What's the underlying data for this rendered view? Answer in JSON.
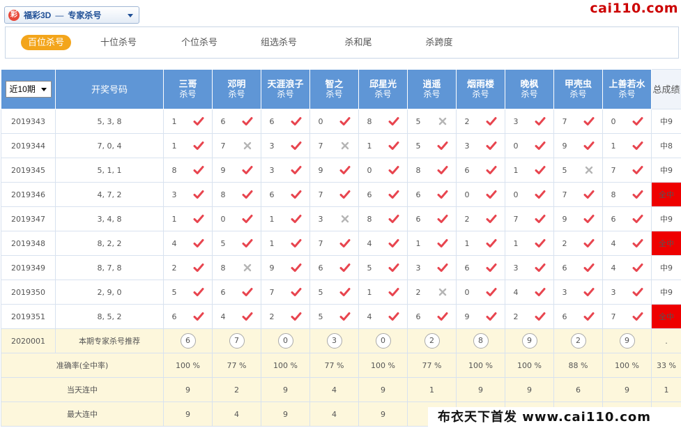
{
  "header": {
    "game_logo": "彩",
    "game_name": "福彩3D",
    "game_sep": "—",
    "game_sub": "专家杀号",
    "brand": "cai110.com"
  },
  "tabs": [
    {
      "label": "百位杀号",
      "active": true
    },
    {
      "label": "十位杀号",
      "active": false
    },
    {
      "label": "个位杀号",
      "active": false
    },
    {
      "label": "组选杀号",
      "active": false
    },
    {
      "label": "杀和尾",
      "active": false
    },
    {
      "label": "杀跨度",
      "active": false
    }
  ],
  "table": {
    "period_select": "近10期",
    "draw_header": "开奖号码",
    "total_header": "总成绩",
    "expert_sub": "杀号",
    "experts": [
      "三哥",
      "邓明",
      "天涯浪子",
      "智之",
      "邱星光",
      "逍遥",
      "烟雨楼",
      "晚枫",
      "甲壳虫",
      "上善若水"
    ],
    "rows": [
      {
        "period": "2019343",
        "draw": "5, 3, 8",
        "picks": [
          [
            1,
            1
          ],
          [
            6,
            1
          ],
          [
            6,
            1
          ],
          [
            0,
            1
          ],
          [
            8,
            1
          ],
          [
            5,
            0
          ],
          [
            2,
            1
          ],
          [
            3,
            1
          ],
          [
            7,
            1
          ],
          [
            0,
            1
          ]
        ],
        "total": "中9",
        "all": false
      },
      {
        "period": "2019344",
        "draw": "7, 0, 4",
        "picks": [
          [
            1,
            1
          ],
          [
            7,
            0
          ],
          [
            3,
            1
          ],
          [
            7,
            0
          ],
          [
            1,
            1
          ],
          [
            5,
            1
          ],
          [
            3,
            1
          ],
          [
            0,
            1
          ],
          [
            9,
            1
          ],
          [
            1,
            1
          ]
        ],
        "total": "中8",
        "all": false
      },
      {
        "period": "2019345",
        "draw": "5, 1, 1",
        "picks": [
          [
            8,
            1
          ],
          [
            9,
            1
          ],
          [
            3,
            1
          ],
          [
            9,
            1
          ],
          [
            0,
            1
          ],
          [
            8,
            1
          ],
          [
            6,
            1
          ],
          [
            1,
            1
          ],
          [
            5,
            0
          ],
          [
            7,
            1
          ]
        ],
        "total": "中9",
        "all": false
      },
      {
        "period": "2019346",
        "draw": "4, 7, 2",
        "picks": [
          [
            3,
            1
          ],
          [
            8,
            1
          ],
          [
            6,
            1
          ],
          [
            7,
            1
          ],
          [
            6,
            1
          ],
          [
            6,
            1
          ],
          [
            0,
            1
          ],
          [
            0,
            1
          ],
          [
            7,
            1
          ],
          [
            8,
            1
          ]
        ],
        "total": "全中",
        "all": true
      },
      {
        "period": "2019347",
        "draw": "3, 4, 8",
        "picks": [
          [
            1,
            1
          ],
          [
            0,
            1
          ],
          [
            1,
            1
          ],
          [
            3,
            0
          ],
          [
            8,
            1
          ],
          [
            6,
            1
          ],
          [
            2,
            1
          ],
          [
            7,
            1
          ],
          [
            9,
            1
          ],
          [
            6,
            1
          ]
        ],
        "total": "中9",
        "all": false
      },
      {
        "period": "2019348",
        "draw": "8, 2, 2",
        "picks": [
          [
            4,
            1
          ],
          [
            5,
            1
          ],
          [
            1,
            1
          ],
          [
            7,
            1
          ],
          [
            4,
            1
          ],
          [
            1,
            1
          ],
          [
            1,
            1
          ],
          [
            1,
            1
          ],
          [
            2,
            1
          ],
          [
            4,
            1
          ]
        ],
        "total": "全中",
        "all": true
      },
      {
        "period": "2019349",
        "draw": "8, 7, 8",
        "picks": [
          [
            2,
            1
          ],
          [
            8,
            0
          ],
          [
            9,
            1
          ],
          [
            6,
            1
          ],
          [
            5,
            1
          ],
          [
            3,
            1
          ],
          [
            6,
            1
          ],
          [
            3,
            1
          ],
          [
            6,
            1
          ],
          [
            4,
            1
          ]
        ],
        "total": "中9",
        "all": false
      },
      {
        "period": "2019350",
        "draw": "2, 9, 0",
        "picks": [
          [
            5,
            1
          ],
          [
            6,
            1
          ],
          [
            7,
            1
          ],
          [
            5,
            1
          ],
          [
            1,
            1
          ],
          [
            2,
            0
          ],
          [
            0,
            1
          ],
          [
            4,
            1
          ],
          [
            3,
            1
          ],
          [
            3,
            1
          ]
        ],
        "total": "中9",
        "all": false
      },
      {
        "period": "2019351",
        "draw": "8, 5, 2",
        "picks": [
          [
            6,
            1
          ],
          [
            4,
            1
          ],
          [
            2,
            1
          ],
          [
            5,
            1
          ],
          [
            4,
            1
          ],
          [
            6,
            1
          ],
          [
            9,
            1
          ],
          [
            2,
            1
          ],
          [
            6,
            1
          ],
          [
            7,
            1
          ]
        ],
        "total": "全中",
        "all": true
      }
    ],
    "recommend": {
      "period": "2020001",
      "label": "本期专家杀号推荐",
      "values": [
        "6",
        "7",
        "0",
        "3",
        "0",
        "2",
        "8",
        "9",
        "2",
        "9"
      ],
      "total": "."
    },
    "stats": [
      {
        "label": "准确率(全中率)",
        "values": [
          "100 %",
          "77 %",
          "100 %",
          "77 %",
          "100 %",
          "77 %",
          "100 %",
          "100 %",
          "88 %",
          "100 %"
        ],
        "total": "33 %"
      },
      {
        "label": "当天连中",
        "values": [
          "9",
          "2",
          "9",
          "4",
          "9",
          "1",
          "9",
          "9",
          "6",
          "9"
        ],
        "total": "1"
      },
      {
        "label": "最大连中",
        "values": [
          "9",
          "4",
          "9",
          "4",
          "9",
          "",
          "",
          "",
          "",
          ""
        ],
        "total": ""
      }
    ]
  },
  "watermark": "布衣天下首发 www.cai110.com",
  "colors": {
    "header_blue": "#5f96d6",
    "tab_active": "#f3a51b",
    "hit": "#e8454f",
    "miss": "#b5b5b5",
    "all_hit": "#ee0000",
    "rec_bg": "#fdf7dc"
  }
}
